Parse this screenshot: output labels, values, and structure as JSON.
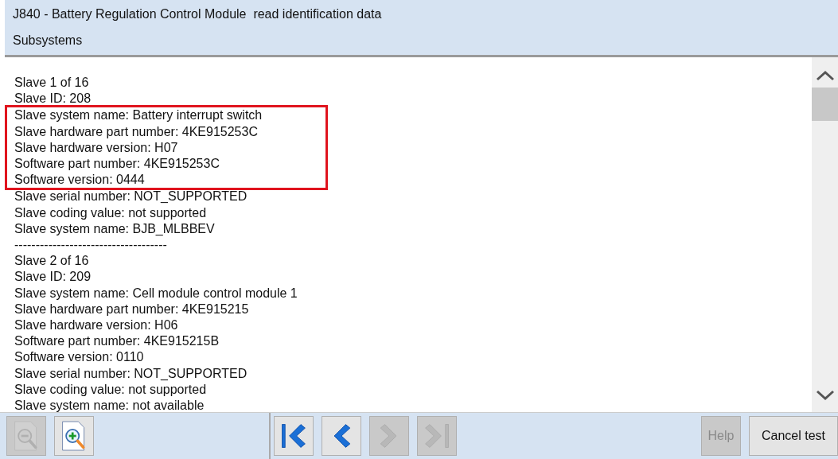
{
  "header": {
    "title": "J840 - Battery Regulation Control Module  read identification data",
    "subtitle": "Subsystems"
  },
  "blocks": [
    {
      "kind": "plain",
      "lines": [
        "Slave 1 of 16",
        "Slave ID: 208"
      ]
    },
    {
      "kind": "highlight",
      "lines": [
        "Slave system name: Battery interrupt switch",
        "Slave hardware part number: 4KE915253C",
        "Slave hardware version: H07",
        "Software part number: 4KE915253C",
        "Software version: 0444"
      ]
    },
    {
      "kind": "plain",
      "lines": [
        "Slave serial number: NOT_SUPPORTED",
        "Slave coding value: not supported",
        "Slave system name: BJB_MLBBEV",
        "------------------------------------",
        "Slave 2 of 16",
        "Slave ID: 209",
        "Slave system name: Cell module control module 1",
        "Slave hardware part number: 4KE915215",
        "Slave hardware version: H06",
        "Software part number: 4KE915215B",
        "Software version: 0110",
        "Slave serial number: NOT_SUPPORTED",
        "Slave coding value: not supported",
        "Slave system name: not available"
      ]
    }
  ],
  "toolbar": {
    "zoom_buttons": [
      {
        "kind": "zoom-out",
        "disabled": true
      },
      {
        "kind": "zoom-in",
        "disabled": false
      }
    ],
    "nav_buttons": [
      {
        "kind": "first",
        "disabled": false
      },
      {
        "kind": "previous",
        "disabled": false
      },
      {
        "kind": "next",
        "disabled": true
      },
      {
        "kind": "last",
        "disabled": true
      }
    ],
    "help": {
      "label": "Help",
      "disabled": true
    },
    "cancel": {
      "label": "Cancel test",
      "disabled": false
    }
  }
}
